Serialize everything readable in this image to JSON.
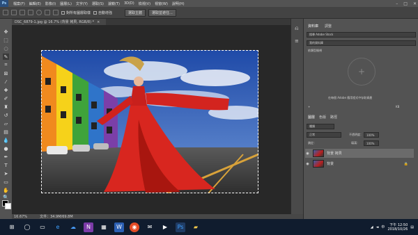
{
  "app": {
    "logo": "Ps"
  },
  "menu": [
    "檔案(F)",
    "編輯(E)",
    "影像(I)",
    "圖層(L)",
    "文字(Y)",
    "選取(S)",
    "濾鏡(T)",
    "3D(D)",
    "檢視(V)",
    "視窗(W)",
    "說明(H)"
  ],
  "options": {
    "sample_all_layers": "對所有圖層取樣",
    "auto_enhance": "自動增強",
    "select_subject": "選取主體",
    "select_and_mask": "選取並遮住..."
  },
  "document": {
    "tab_title": "DSC_6879-1.jpg @ 16.7% (背景 拷貝, RGB/8) *",
    "close": "×"
  },
  "status": {
    "zoom": "16.67%",
    "doc_size": "文件：34.9M/69.8M"
  },
  "library": {
    "tab_library": "資料庫",
    "tab_adjust": "調整",
    "search_placeholder": "搜尋 Adobe Stock",
    "selected_library": "我的資料庫",
    "view_label": "依類型檢視",
    "empty_hint": "在每個 Adobe 應用程式中存取資產",
    "size": "KB"
  },
  "layers_panel": {
    "tab_layers": "圖層",
    "tab_channels": "色版",
    "tab_paths": "路徑",
    "kind_label": "種類",
    "blend_mode": "正常",
    "opacity_label": "不透明度：",
    "opacity_value": "100%",
    "lock_label": "鎖定：",
    "fill_label": "填滿：",
    "fill_value": "100%",
    "layers": [
      {
        "name": "背景 拷貝",
        "selected": true
      },
      {
        "name": "背景",
        "selected": false
      }
    ]
  },
  "taskbar": {
    "icons": [
      "windows-start",
      "search",
      "task-view",
      "edge",
      "onedrive",
      "onenote",
      "store",
      "word",
      "chrome",
      "mail",
      "media",
      "photoshop",
      "explorer"
    ],
    "tray_text": "中",
    "time": "下午 12:50",
    "date": "2018/10/26"
  }
}
